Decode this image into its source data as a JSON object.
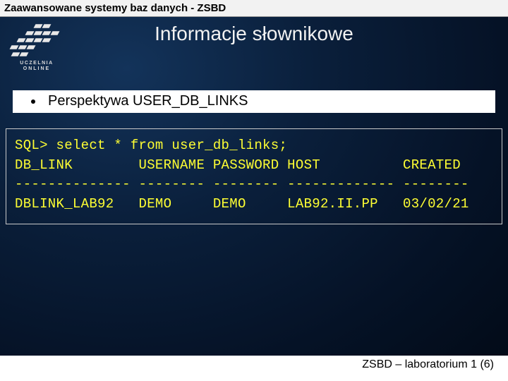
{
  "header": {
    "breadcrumb": "Zaawansowane systemy baz danych - ZSBD"
  },
  "title": "Informacje słownikowe",
  "logo": {
    "line1": "UCZELNIA",
    "line2": "ONLINE"
  },
  "bullet": {
    "text": "Perspektywa USER_DB_LINKS"
  },
  "sql": {
    "prompt_line": "SQL> select * from user_db_links;",
    "blank": "",
    "header_line": "DB_LINK        USERNAME PASSWORD HOST          CREATED",
    "divider_line": "-------------- -------- -------- ------------- --------",
    "row_line": "DBLINK_LAB92   DEMO     DEMO     LAB92.II.PP   03/02/21"
  },
  "chart_data": {
    "type": "table",
    "title": "user_db_links",
    "columns": [
      "DB_LINK",
      "USERNAME",
      "PASSWORD",
      "HOST",
      "CREATED"
    ],
    "rows": [
      [
        "DBLINK_LAB92",
        "DEMO",
        "DEMO",
        "LAB92.II.PP",
        "03/02/21"
      ]
    ]
  },
  "footer": {
    "text": "ZSBD – laboratorium 1 (6)"
  }
}
